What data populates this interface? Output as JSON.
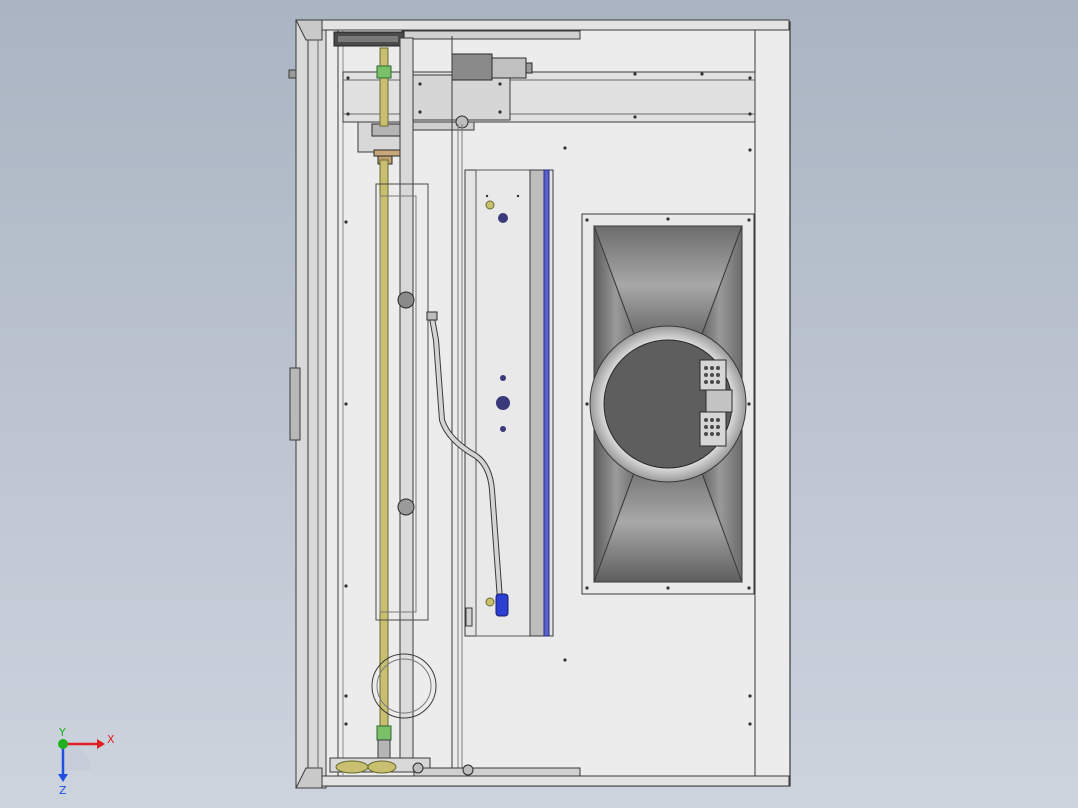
{
  "viewport": {
    "background_top": "#aab4c2",
    "background_bottom": "#cdd4de"
  },
  "model": {
    "part_color": "#e9e9e9",
    "edge_color": "#3a3a3a",
    "rod_color": "#c8c070",
    "fitting_color": "#7cbf6a",
    "handle_color": "#2c3fd0",
    "rail_color": "#5a62c8"
  },
  "triad": {
    "x_label": "X",
    "y_label": "Y",
    "z_label": "Z",
    "x_color": "#e02020",
    "y_color": "#20b020",
    "z_color": "#2050e0"
  }
}
